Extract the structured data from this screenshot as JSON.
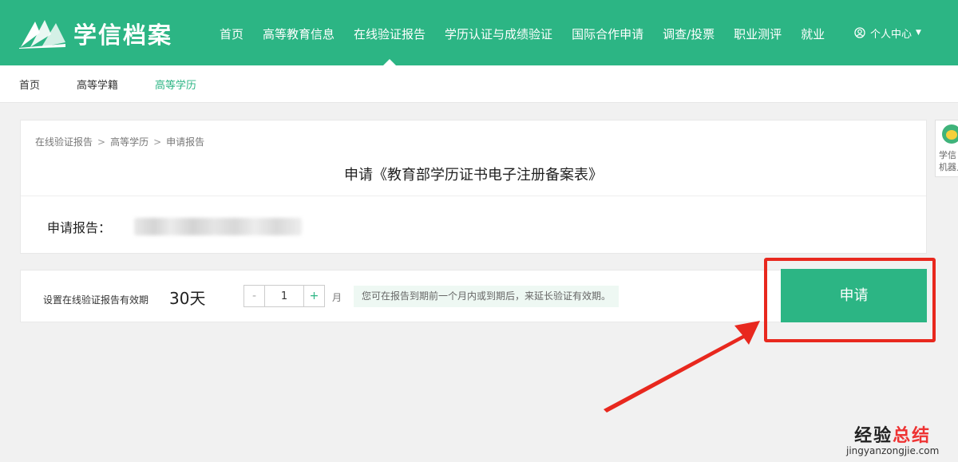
{
  "header": {
    "logo_text": "学信档案",
    "nav": [
      {
        "label": "首页"
      },
      {
        "label": "高等教育信息"
      },
      {
        "label": "在线验证报告"
      },
      {
        "label": "学历认证与成绩验证"
      },
      {
        "label": "国际合作申请"
      },
      {
        "label": "调查/投票"
      },
      {
        "label": "职业测评"
      },
      {
        "label": "就业"
      }
    ],
    "active_nav": "在线验证报告",
    "user_menu": "个人中心"
  },
  "subnav": {
    "items": [
      {
        "label": "首页"
      },
      {
        "label": "高等学籍"
      },
      {
        "label": "高等学历"
      }
    ],
    "active": "高等学历"
  },
  "breadcrumb": {
    "items": [
      "在线验证报告",
      "高等学历",
      "申请报告"
    ],
    "separator": ">"
  },
  "main": {
    "title": "申请《教育部学历证书电子注册备案表》",
    "report_label": "申请报告："
  },
  "validity": {
    "label": "设置在线验证报告有效期",
    "days": "30天",
    "minus": "-",
    "plus": "+",
    "value": "1",
    "unit": "月",
    "hint": "您可在报告到期前一个月内或到期后，来延长验证有效期。"
  },
  "apply_button": "申请",
  "assistant": {
    "line1": "学信",
    "line2": "机器人"
  },
  "watermark": {
    "part1": "经验",
    "part2": "总结",
    "url": "jingyanzongjie.com"
  },
  "colors": {
    "brand": "#2cb584",
    "highlight": "#e8281e",
    "hint_bg": "#eef8f3"
  }
}
